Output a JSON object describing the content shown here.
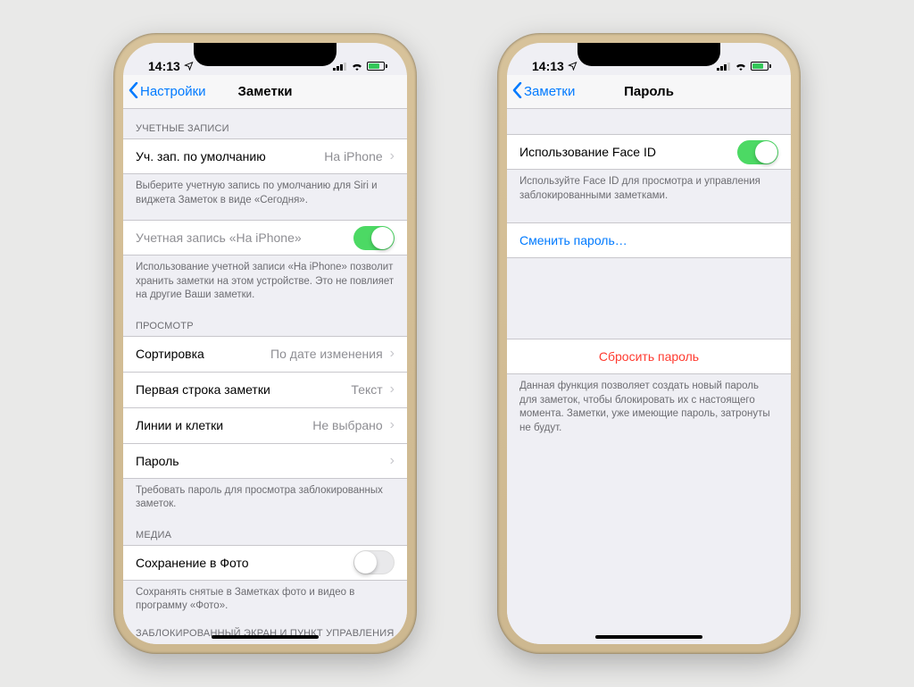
{
  "status": {
    "time": "14:13"
  },
  "left": {
    "nav": {
      "back": "Настройки",
      "title": "Заметки"
    },
    "sections": {
      "accounts": {
        "header": "УЧЕТНЫЕ ЗАПИСИ",
        "default_account_label": "Уч. зап. по умолчанию",
        "default_account_value": "На iPhone",
        "default_account_footer": "Выберите учетную запись по умолчанию для Siri и виджета Заметок в виде «Сегодня».",
        "on_iphone_label": "Учетная запись «На iPhone»",
        "on_iphone_footer": "Использование учетной записи «На iPhone» позволит хранить заметки на этом устройстве. Это не повлияет на другие Ваши заметки."
      },
      "view": {
        "header": "ПРОСМОТР",
        "sort_label": "Сортировка",
        "sort_value": "По дате изменения",
        "first_line_label": "Первая строка заметки",
        "first_line_value": "Текст",
        "lines_label": "Линии и клетки",
        "lines_value": "Не выбрано",
        "password_label": "Пароль",
        "password_footer": "Требовать пароль для просмотра заблокированных заметок."
      },
      "media": {
        "header": "МЕДИА",
        "save_photo_label": "Сохранение в Фото",
        "save_photo_footer": "Сохранять снятые в Заметках фото и видео в программу «Фото»."
      },
      "locked": {
        "header": "ЗАБЛОКИРОВАННЫЙ ЭКРАН И ПУНКТ УПРАВЛЕНИЯ"
      }
    }
  },
  "right": {
    "nav": {
      "back": "Заметки",
      "title": "Пароль"
    },
    "faceid_label": "Использование Face ID",
    "faceid_footer": "Используйте Face ID для просмотра и управления заблокированными заметками.",
    "change_password": "Сменить пароль…",
    "reset_password": "Сбросить пароль",
    "reset_footer": "Данная функция позволяет создать новый пароль для заметок, чтобы блокировать их с настоящего момента. Заметки, уже имеющие пароль, затронуты не будут."
  }
}
